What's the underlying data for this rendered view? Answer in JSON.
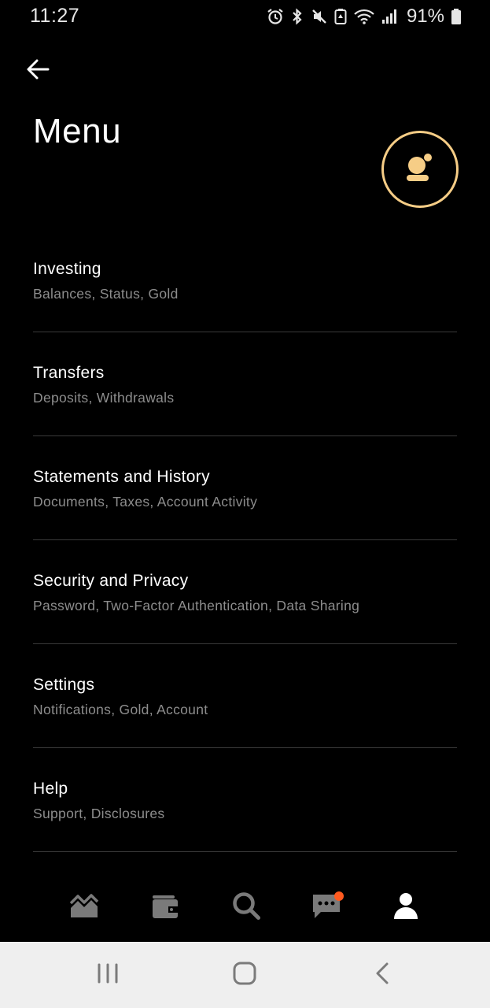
{
  "status_bar": {
    "time": "11:27",
    "battery_percent": "91%",
    "icons": [
      "alarm-icon",
      "bluetooth-icon",
      "mute-icon",
      "battery-saver-icon",
      "wifi-icon",
      "signal-icon",
      "battery-icon"
    ]
  },
  "header": {
    "title": "Menu",
    "back_icon": "arrow-left-icon",
    "avatar_icon": "user-avatar-icon"
  },
  "menu": {
    "items": [
      {
        "title": "Investing",
        "subtitle": "Balances, Status, Gold"
      },
      {
        "title": "Transfers",
        "subtitle": "Deposits, Withdrawals"
      },
      {
        "title": "Statements and History",
        "subtitle": "Documents, Taxes, Account Activity"
      },
      {
        "title": "Security and Privacy",
        "subtitle": "Password, Two-Factor Authentication, Data Sharing"
      },
      {
        "title": "Settings",
        "subtitle": "Notifications, Gold, Account"
      },
      {
        "title": "Help",
        "subtitle": "Support, Disclosures"
      }
    ]
  },
  "tab_bar": {
    "tabs": [
      "chart-icon",
      "wallet-icon",
      "search-icon",
      "messages-icon",
      "account-icon"
    ],
    "active": "account-icon",
    "notification_dot": "messages-icon"
  },
  "system_nav": {
    "buttons": [
      "recents-icon",
      "home-icon",
      "back-icon"
    ]
  },
  "colors": {
    "background": "#000000",
    "accent": "#f6cd86",
    "subtitle": "#8d8d8d",
    "divider": "#3a3a3a",
    "inactive_tab": "#7a7a7a",
    "notification": "#ff5a1f"
  }
}
